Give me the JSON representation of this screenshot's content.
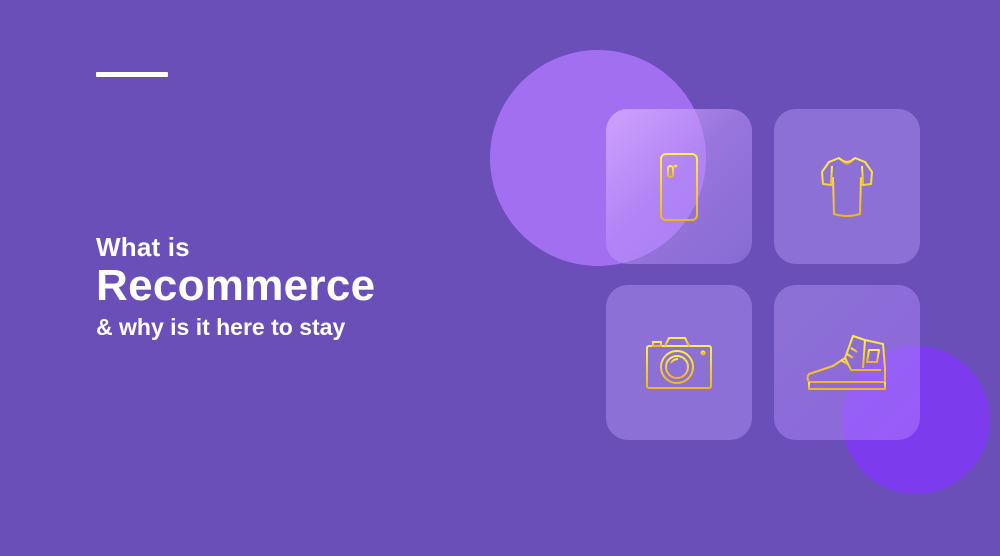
{
  "headline": {
    "line1": "What is",
    "line2": "Recommerce",
    "line3": "& why is it here to stay"
  },
  "tiles": [
    {
      "icon": "smartphone-icon"
    },
    {
      "icon": "tshirt-icon"
    },
    {
      "icon": "camera-icon"
    },
    {
      "icon": "sneaker-icon"
    }
  ],
  "colors": {
    "background": "#6a4fb8",
    "text": "#ffffff",
    "blob_big": "#a26ff0",
    "blob_small": "#7d3bee",
    "icon_gradient_start": "#ffe83a",
    "icon_gradient_end": "#f0b21f"
  }
}
